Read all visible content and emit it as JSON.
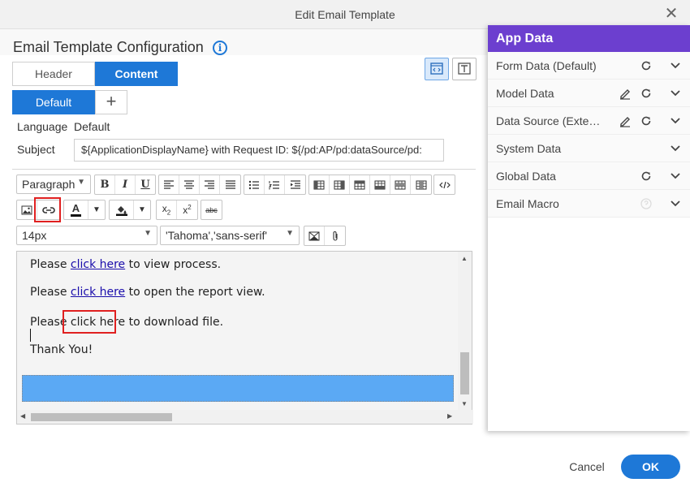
{
  "window": {
    "title": "Edit Email Template"
  },
  "config": {
    "title": "Email Template Configuration"
  },
  "tabs": [
    {
      "label": "Header"
    },
    {
      "label": "Content"
    }
  ],
  "language_tab": {
    "label": "Default",
    "add_label": "+"
  },
  "fields": {
    "language_label": "Language",
    "language_value": "Default",
    "subject_label": "Subject",
    "subject_value": "${ApplicationDisplayName} with Request ID: ${/pd:AP/pd:dataSource/pd:"
  },
  "toolbar": {
    "paragraph": "Paragraph",
    "bold": "B",
    "italic": "I",
    "underline": "U",
    "font_size": "14px",
    "font_family": "'Tahoma','sans-serif'"
  },
  "editor": {
    "lines": [
      {
        "pre": "Please ",
        "link": "click here",
        "post": " to view process."
      },
      {
        "pre": "Please ",
        "link": "click here",
        "post": " to open the report view."
      },
      {
        "pre": "Please ",
        "link": "click here",
        "post": " to download file."
      }
    ],
    "closing": "Thank You!"
  },
  "app_data": {
    "title": "App Data",
    "items": [
      {
        "label": "Form Data (Default)"
      },
      {
        "label": "Model Data"
      },
      {
        "label": "Data Source (Exter…"
      },
      {
        "label": "System Data"
      },
      {
        "label": "Global Data"
      },
      {
        "label": "Email Macro"
      }
    ]
  },
  "buttons": {
    "cancel": "Cancel",
    "ok": "OK"
  },
  "colors": {
    "accent": "#1e78d7",
    "panel_header": "#6c3fcf",
    "highlight": "#e02020",
    "selection": "#5ba9f4"
  }
}
